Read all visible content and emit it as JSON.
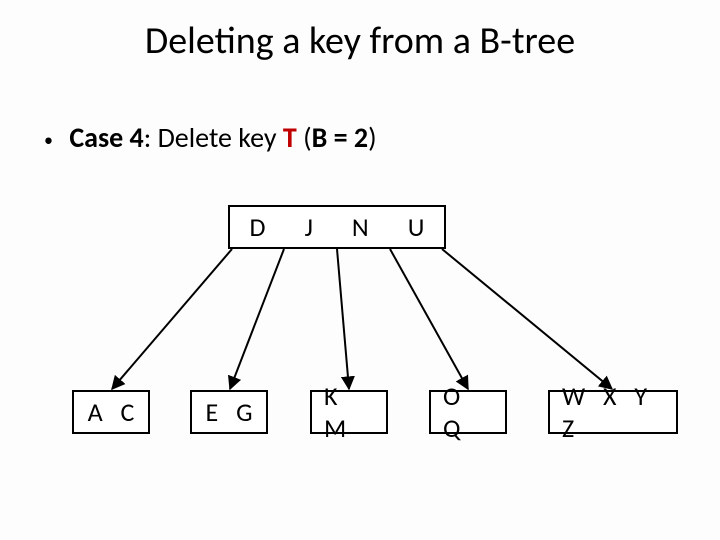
{
  "title": "Deleting a key from a B-tree",
  "bullet": {
    "case_label": "Case 4",
    "delete_prefix": ": Delete key ",
    "key": "T",
    "spacer": "  (",
    "b_label": "B = 2",
    "close": ")"
  },
  "root": {
    "k0": "D",
    "k1": "J",
    "k2": "N",
    "k3": "U"
  },
  "leaves": {
    "l0": "A C",
    "l1": "E G",
    "l2": "K M",
    "l3": "O Q",
    "l4": "W X Y Z"
  }
}
